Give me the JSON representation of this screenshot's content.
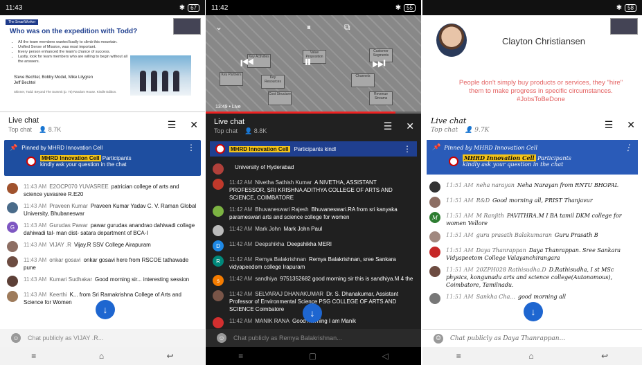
{
  "phone1": {
    "status": {
      "time": "11:43",
      "battery": "67"
    },
    "slide": {
      "tag": "The SmartWorker",
      "title": "Who was on the expedition with Todd?",
      "bullets": [
        "All the team members wanted badly to climb this mountain.",
        "Unified Sense of Mission, was most important.",
        "Every person enhanced the team's chance of success.",
        "Lastly, look for team members who are willing to begin without all the answers."
      ],
      "names": [
        "Steve Bechtel, Bobby Model, Mike Lilygren",
        "Jeff Bechtel"
      ],
      "ref": "Skinner, Todd: Beyond The Summit (p. 76) Random House. Kindle Edition."
    },
    "chat": {
      "title": "Live chat",
      "mode": "Top chat",
      "viewers": "8.7K"
    },
    "pinned": {
      "label": "Pinned by MHRD Innovation Cell",
      "author": "MHRD Innovation Cell",
      "text1": "Participants",
      "text2": "kindly ask your question in the chat"
    },
    "messages": [
      {
        "time": "11:43 AM",
        "name": "E2OCP070 YUVASREE",
        "text": "patrician college of arts and science yuvasree R.E20",
        "color": "#a0522d",
        "initial": ""
      },
      {
        "time": "11:43 AM",
        "name": "Praveen Kumar",
        "text": "Praveen Kumar Yadav C. V. Raman Global University, Bhubaneswar",
        "color": "#4a6b8a",
        "initial": ""
      },
      {
        "time": "11:43 AM",
        "name": "Gurudas Pawar",
        "text": "pawar gurudas anandrao dahiwadi collage dahiwadi tal- man dist- satara department of BCA-I",
        "color": "#7e57c2",
        "initial": "G"
      },
      {
        "time": "11:43 AM",
        "name": "VIJAY .R",
        "text": "Vijay.R SSV College Airapuram",
        "color": "#8d6e63",
        "initial": ""
      },
      {
        "time": "11:43 AM",
        "name": "onkar gosavi",
        "text": "onkar gosavi here from RSCOE tathawade pune",
        "color": "#6d4c41",
        "initial": ""
      },
      {
        "time": "11:43 AM",
        "name": "Kumari Sudhakar",
        "text": "Good morning sir... interesting session",
        "color": "#5d4037",
        "initial": ""
      },
      {
        "time": "11:43 AM",
        "name": "Keerthi",
        "text": "K... from Sri Ramakrishna College of Arts and Science for Women",
        "color": "#9e7b5b",
        "initial": ""
      }
    ],
    "input_placeholder": "Chat publicly as VIJAY .R..."
  },
  "phone2": {
    "status": {
      "time": "11:42",
      "battery": "55"
    },
    "video": {
      "timecode": "13:49  •  Live",
      "labels": [
        "Key Activities",
        "Key Partners",
        "Value Proposition",
        "Channels",
        "Customer Segments",
        "Revenue Streams",
        "Cost Structure",
        "Key Resources"
      ]
    },
    "chat": {
      "title": "Live chat",
      "mode": "Top chat",
      "viewers": "8.8K"
    },
    "pinned": {
      "author": "MHRD Innovation Cell",
      "text": "Participants kindl"
    },
    "messages": [
      {
        "time": "",
        "name": "",
        "text": "University of Hyderabad",
        "color": "#b0403a",
        "initial": ""
      },
      {
        "time": "11:42 AM",
        "name": "Nivetha Sathish Kumar",
        "text": "A NIVETHA, ASSISTANT PROFESSOR, SRI KRISHNA ADITHYA COLLEGE OF ARTS AND SCIENCE, COIMBATORE",
        "color": "#c0392b",
        "initial": ""
      },
      {
        "time": "11:42 AM",
        "name": "Bhuvaneswari Rajesh",
        "text": "Bhuvaneswari.RA from sri kanyaka parameswari arts and science college for women",
        "color": "#7cb342",
        "initial": ""
      },
      {
        "time": "11:42 AM",
        "name": "Mark John",
        "text": "Mark John Paul",
        "color": "#bbb",
        "initial": ""
      },
      {
        "time": "11:42 AM",
        "name": "Deepshikha",
        "text": "Deepshikha MERI",
        "color": "#1e88e5",
        "initial": "D"
      },
      {
        "time": "11:42 AM",
        "name": "Remya Balakrishnan",
        "text": "Remya Balakrishnan, sree Sankara vidyapeedom college Irapuram",
        "color": "#00897b",
        "initial": "R"
      },
      {
        "time": "11:42 AM",
        "name": "sandhiya",
        "text": "9751352682 good morning sir this is sandhiya.M 4 the",
        "color": "#f57c00",
        "initial": "s"
      },
      {
        "time": "11:42 AM",
        "name": "SELVARAJ DHANAKUMAR",
        "text": "Dr. S. Dhanakumar, Assistant Professor of Environmental Science PSG COLLEGE OF ARTS AND SCIENCE Coimbatore",
        "color": "#795548",
        "initial": ""
      },
      {
        "time": "11:42 AM",
        "name": "MANIK RANA",
        "text": "Good morning I am Manik",
        "color": "#d32f2f",
        "initial": ""
      }
    ],
    "input_placeholder": "Chat publicly as Remya Balakrishnan..."
  },
  "phone3": {
    "status": {
      "time": "",
      "battery": "58"
    },
    "video": {
      "presenter": "Clayton Christiansen",
      "quote": "People don't simply buy products or services, they \"hire\" them to make progress in specific circumstances. #JobsToBeDone"
    },
    "chat": {
      "title": "Live chat",
      "mode": "Top chat",
      "viewers": "9.7K"
    },
    "pinned": {
      "label": "Pinned by MHRD Innovation Cell",
      "author": "MHRD Innovation Cell",
      "text1": "Participants",
      "text2": "kindly ask your question in the chat"
    },
    "messages": [
      {
        "time": "11:51 AM",
        "name": "neha narayan",
        "text": "Neha Narayan from RNTU BHOPAL",
        "color": "#333",
        "initial": ""
      },
      {
        "time": "11:51 AM",
        "name": "R&D",
        "text": "Good morning all, PRIST Thanjavur",
        "color": "#8d6e63",
        "initial": ""
      },
      {
        "time": "11:51 AM",
        "name": "M Ranjith",
        "text": "PAVITHRA.M I BA tamil DKM college for women Vellore",
        "color": "#2e7d32",
        "initial": "M"
      },
      {
        "time": "11:51 AM",
        "name": "guru prasath Balakumaran",
        "text": "Guru Prasath B",
        "color": "#a1887f",
        "initial": ""
      },
      {
        "time": "11:51 AM",
        "name": "Daya Thanrappan",
        "text": "Daya Thanrappan. Sree Sankara Vidyapeetom College Valayanchirangara",
        "color": "#c62828",
        "initial": ""
      },
      {
        "time": "11:51 AM",
        "name": "20ZPH028 Rathisudha.D",
        "text": "D.Rathisudha, I st MSc physics, kongunadu arts and science college(Autonomous), Coimbatore, Tamilnadu.",
        "color": "#6d4c41",
        "initial": ""
      },
      {
        "time": "11:51 AM",
        "name": "Sankha Cha...",
        "text": "good morning all",
        "color": "#777",
        "initial": ""
      }
    ],
    "input_placeholder": "Chat publicly as Daya Thanrappan..."
  }
}
